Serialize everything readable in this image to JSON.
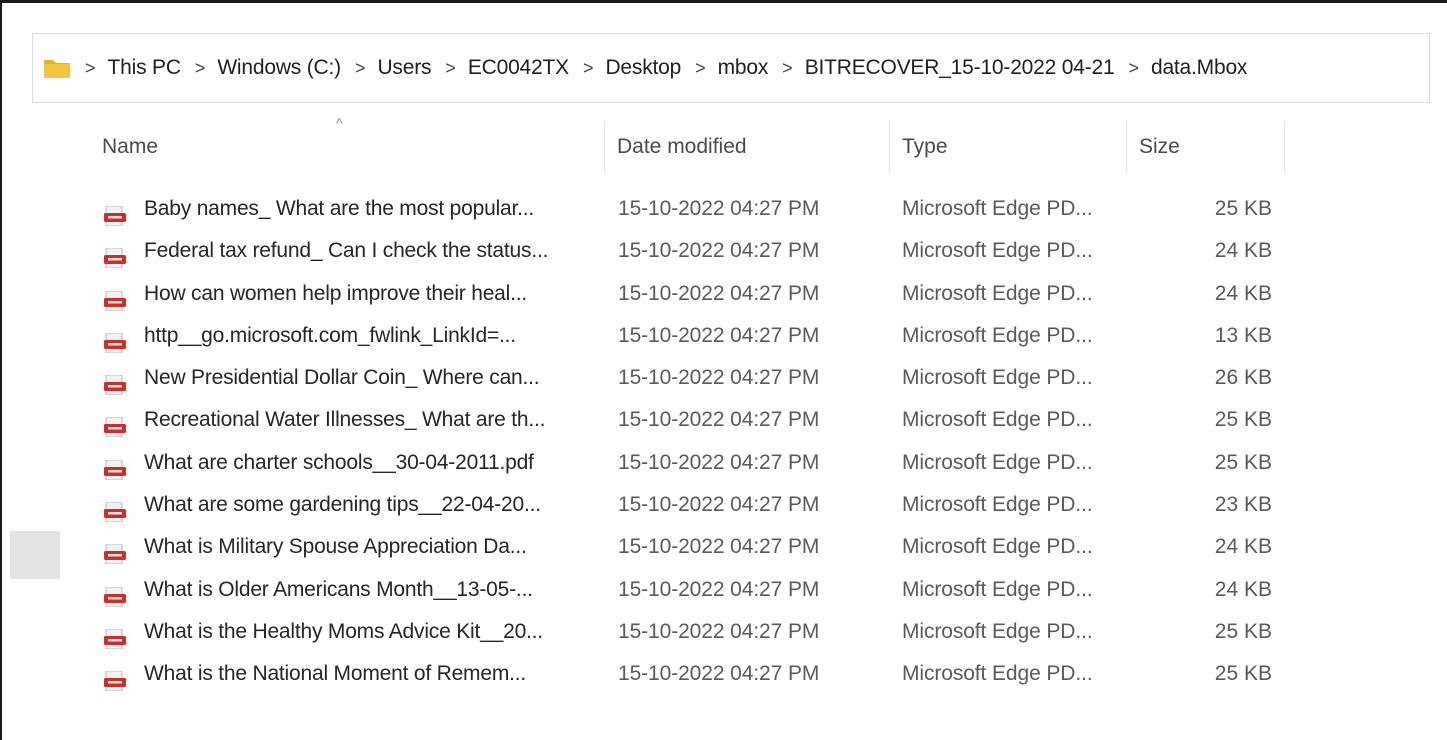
{
  "breadcrumb": {
    "items": [
      "This PC",
      "Windows (C:)",
      "Users",
      "EC0042TX",
      "Desktop",
      "mbox",
      "BITRECOVER_15-10-2022 04-21",
      "data.Mbox"
    ],
    "separator": ">"
  },
  "columns": {
    "name": "Name",
    "date_modified": "Date modified",
    "type": "Type",
    "size": "Size",
    "sort_indicator": "^"
  },
  "files": [
    {
      "name": "Baby names_ What are the most popular...",
      "date": "15-10-2022 04:27 PM",
      "type": "Microsoft Edge PD...",
      "size": "25 KB"
    },
    {
      "name": "Federal tax refund_ Can I check the status...",
      "date": "15-10-2022 04:27 PM",
      "type": "Microsoft Edge PD...",
      "size": "24 KB"
    },
    {
      "name": "How can women help improve their heal...",
      "date": "15-10-2022 04:27 PM",
      "type": "Microsoft Edge PD...",
      "size": "24 KB"
    },
    {
      "name": "http__go.microsoft.com_fwlink_LinkId=...",
      "date": "15-10-2022 04:27 PM",
      "type": "Microsoft Edge PD...",
      "size": "13 KB"
    },
    {
      "name": "New Presidential Dollar Coin_ Where can...",
      "date": "15-10-2022 04:27 PM",
      "type": "Microsoft Edge PD...",
      "size": "26 KB"
    },
    {
      "name": "Recreational Water Illnesses_ What are th...",
      "date": "15-10-2022 04:27 PM",
      "type": "Microsoft Edge PD...",
      "size": "25 KB"
    },
    {
      "name": "What are charter schools__30-04-2011.pdf",
      "date": "15-10-2022 04:27 PM",
      "type": "Microsoft Edge PD...",
      "size": "25 KB"
    },
    {
      "name": "What are some gardening tips__22-04-20...",
      "date": "15-10-2022 04:27 PM",
      "type": "Microsoft Edge PD...",
      "size": "23 KB"
    },
    {
      "name": "What is Military Spouse Appreciation Da...",
      "date": "15-10-2022 04:27 PM",
      "type": "Microsoft Edge PD...",
      "size": "24 KB"
    },
    {
      "name": "What is Older Americans Month__13-05-...",
      "date": "15-10-2022 04:27 PM",
      "type": "Microsoft Edge PD...",
      "size": "24 KB"
    },
    {
      "name": "What is the Healthy Moms Advice Kit__20...",
      "date": "15-10-2022 04:27 PM",
      "type": "Microsoft Edge PD...",
      "size": "25 KB"
    },
    {
      "name": "What is the National Moment of Remem...",
      "date": "15-10-2022 04:27 PM",
      "type": "Microsoft Edge PD...",
      "size": "25 KB"
    }
  ],
  "icons": {
    "folder": "folder-icon",
    "file": "pdf-file-icon"
  },
  "colors": {
    "folder": "#f4c542",
    "pdf_red": "#c8312b"
  }
}
